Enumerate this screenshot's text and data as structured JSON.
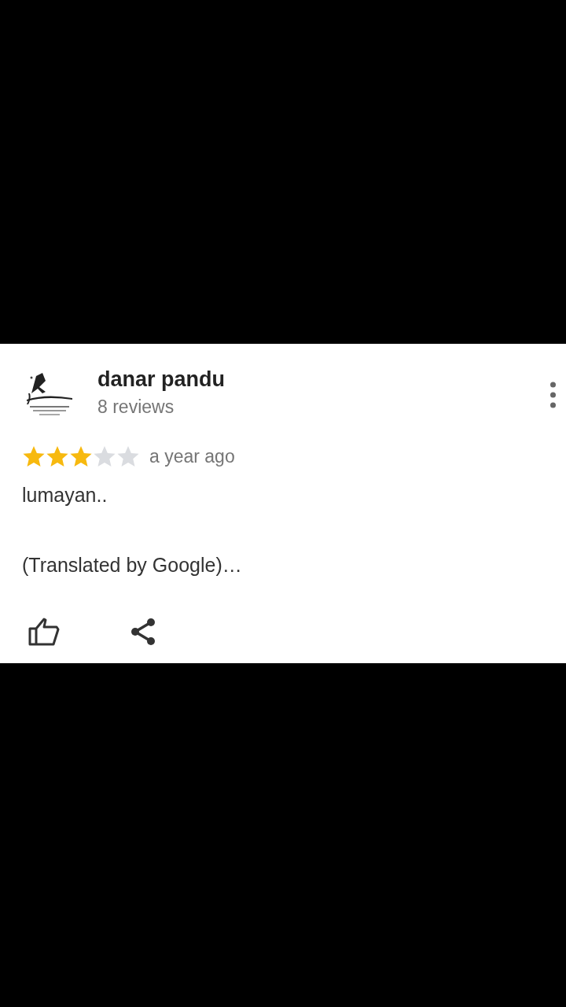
{
  "review": {
    "author": "danar pandu",
    "author_reviews": "8 reviews",
    "stars": 3,
    "time": "a year ago",
    "text": "lumayan..",
    "translation": "(Translated by Google)…"
  }
}
